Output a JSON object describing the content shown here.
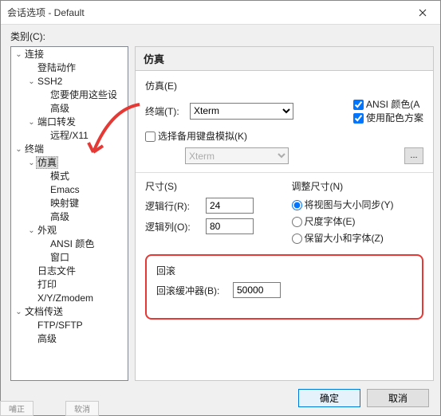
{
  "window": {
    "title": "会话选项 - Default"
  },
  "category_label": "类别(C):",
  "tree": [
    {
      "label": "连接",
      "depth": 0,
      "exp": true
    },
    {
      "label": "登陆动作",
      "depth": 1
    },
    {
      "label": "SSH2",
      "depth": 1,
      "exp": true
    },
    {
      "label": "您要使用这些设",
      "depth": 2
    },
    {
      "label": "高级",
      "depth": 2
    },
    {
      "label": "端口转发",
      "depth": 1,
      "exp": true
    },
    {
      "label": "远程/X11",
      "depth": 2
    },
    {
      "label": "终端",
      "depth": 0,
      "exp": true
    },
    {
      "label": "仿真",
      "depth": 1,
      "exp": true,
      "selected": true
    },
    {
      "label": "模式",
      "depth": 2
    },
    {
      "label": "Emacs",
      "depth": 2
    },
    {
      "label": "映射键",
      "depth": 2
    },
    {
      "label": "高级",
      "depth": 2
    },
    {
      "label": "外观",
      "depth": 1,
      "exp": true
    },
    {
      "label": "ANSI 颜色",
      "depth": 2
    },
    {
      "label": "窗口",
      "depth": 2
    },
    {
      "label": "日志文件",
      "depth": 1
    },
    {
      "label": "打印",
      "depth": 1
    },
    {
      "label": "X/Y/Zmodem",
      "depth": 1
    },
    {
      "label": "文档传送",
      "depth": 0,
      "exp": true
    },
    {
      "label": "FTP/SFTP",
      "depth": 1
    },
    {
      "label": "高级",
      "depth": 1
    }
  ],
  "panel": {
    "title": "仿真",
    "emulation_group": "仿真(E)",
    "terminal_label": "终端(T):",
    "terminal_value": "Xterm",
    "ansi_color": "ANSI 颜色(A",
    "use_scheme": "使用配色方案",
    "alt_kb_label": "选择备用键盘模拟(K)",
    "alt_kb_value": "Xterm",
    "browse": "...",
    "size_group": "尺寸(S)",
    "logical_rows": "逻辑行(R):",
    "rows_value": "24",
    "logical_cols": "逻辑列(O):",
    "cols_value": "80",
    "resize_group": "调整尺寸(N)",
    "radio1": "将视图与大小同步(Y)",
    "radio2": "尺度字体(E)",
    "radio3": "保留大小和字体(Z)",
    "scrollback_group": "回滚",
    "scrollback_label": "回滚缓冲器(B):",
    "scrollback_value": "50000"
  },
  "buttons": {
    "ok": "确定",
    "cancel": "取消"
  },
  "clipped": {
    "a": "哺正",
    "b": "软消"
  }
}
